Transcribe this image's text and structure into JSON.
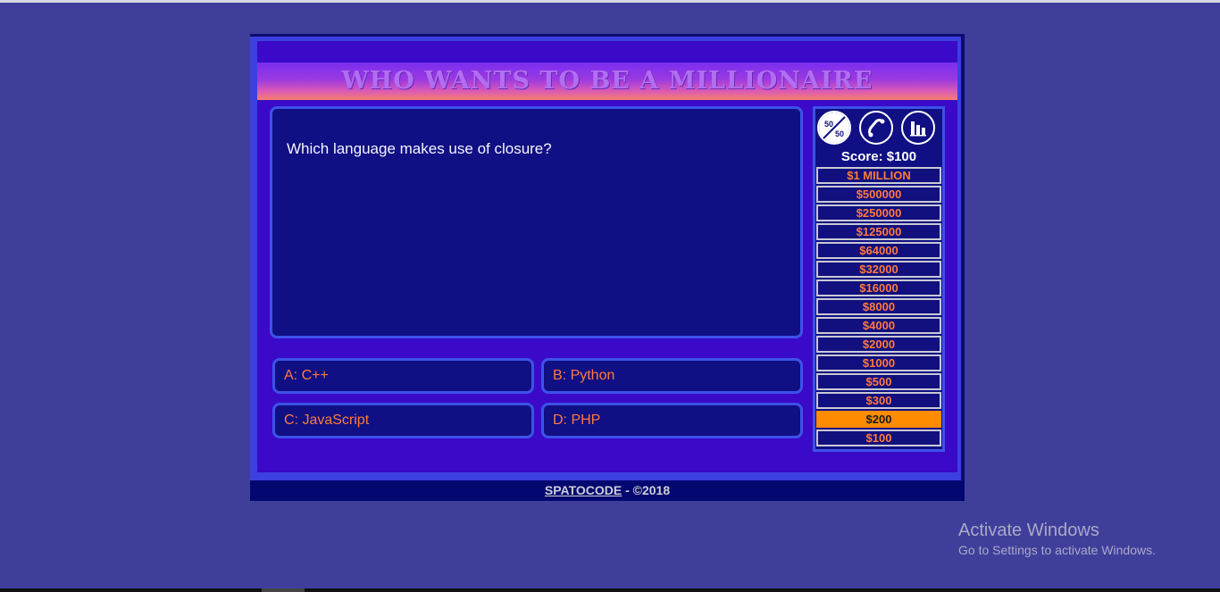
{
  "game": {
    "title": "Who wants to be a millionaire",
    "question": "Which language makes use of closure?",
    "answers": [
      {
        "letter": "A",
        "text": "A: C++"
      },
      {
        "letter": "B",
        "text": "B: Python"
      },
      {
        "letter": "C",
        "text": "C: JavaScript"
      },
      {
        "letter": "D",
        "text": "D: PHP"
      }
    ],
    "lifelines": [
      {
        "name": "fifty-fifty",
        "icon": "fifty-fifty-icon",
        "label": "50 50"
      },
      {
        "name": "phone-a-friend",
        "icon": "phone-icon"
      },
      {
        "name": "ask-the-audience",
        "icon": "audience-bar-chart-icon"
      }
    ],
    "score_label": "Score: $100",
    "prize_ladder": [
      "$1 MILLION",
      "$500000",
      "$250000",
      "$125000",
      "$64000",
      "$32000",
      "$16000",
      "$8000",
      "$4000",
      "$2000",
      "$1000",
      "$500",
      "$300",
      "$200",
      "$100"
    ],
    "current_prize": "$200"
  },
  "footer": {
    "brand": "SPATOCODE",
    "copyright": " - ©2018"
  },
  "watermark": {
    "title": "Activate Windows",
    "subtitle": "Go to Settings to activate Windows."
  },
  "colors": {
    "background": "#3f3f9b",
    "panel": "#100f83",
    "border": "#3d52e8",
    "answer_text": "#ff7a3c",
    "highlight": "#ff8b00",
    "title": "#b26ef2"
  }
}
